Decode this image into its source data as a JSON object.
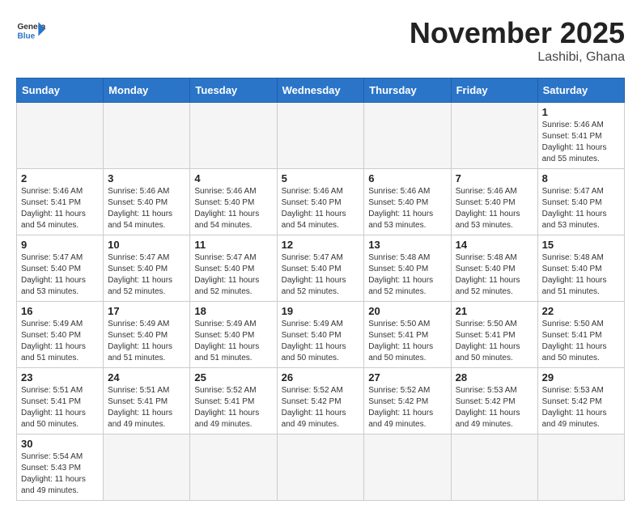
{
  "header": {
    "logo_general": "General",
    "logo_blue": "Blue",
    "month_title": "November 2025",
    "location": "Lashibi, Ghana"
  },
  "weekdays": [
    "Sunday",
    "Monday",
    "Tuesday",
    "Wednesday",
    "Thursday",
    "Friday",
    "Saturday"
  ],
  "days": {
    "1": {
      "sunrise": "5:46 AM",
      "sunset": "5:41 PM",
      "daylight": "11 hours and 55 minutes."
    },
    "2": {
      "sunrise": "5:46 AM",
      "sunset": "5:41 PM",
      "daylight": "11 hours and 54 minutes."
    },
    "3": {
      "sunrise": "5:46 AM",
      "sunset": "5:40 PM",
      "daylight": "11 hours and 54 minutes."
    },
    "4": {
      "sunrise": "5:46 AM",
      "sunset": "5:40 PM",
      "daylight": "11 hours and 54 minutes."
    },
    "5": {
      "sunrise": "5:46 AM",
      "sunset": "5:40 PM",
      "daylight": "11 hours and 54 minutes."
    },
    "6": {
      "sunrise": "5:46 AM",
      "sunset": "5:40 PM",
      "daylight": "11 hours and 53 minutes."
    },
    "7": {
      "sunrise": "5:46 AM",
      "sunset": "5:40 PM",
      "daylight": "11 hours and 53 minutes."
    },
    "8": {
      "sunrise": "5:47 AM",
      "sunset": "5:40 PM",
      "daylight": "11 hours and 53 minutes."
    },
    "9": {
      "sunrise": "5:47 AM",
      "sunset": "5:40 PM",
      "daylight": "11 hours and 53 minutes."
    },
    "10": {
      "sunrise": "5:47 AM",
      "sunset": "5:40 PM",
      "daylight": "11 hours and 52 minutes."
    },
    "11": {
      "sunrise": "5:47 AM",
      "sunset": "5:40 PM",
      "daylight": "11 hours and 52 minutes."
    },
    "12": {
      "sunrise": "5:47 AM",
      "sunset": "5:40 PM",
      "daylight": "11 hours and 52 minutes."
    },
    "13": {
      "sunrise": "5:48 AM",
      "sunset": "5:40 PM",
      "daylight": "11 hours and 52 minutes."
    },
    "14": {
      "sunrise": "5:48 AM",
      "sunset": "5:40 PM",
      "daylight": "11 hours and 52 minutes."
    },
    "15": {
      "sunrise": "5:48 AM",
      "sunset": "5:40 PM",
      "daylight": "11 hours and 51 minutes."
    },
    "16": {
      "sunrise": "5:49 AM",
      "sunset": "5:40 PM",
      "daylight": "11 hours and 51 minutes."
    },
    "17": {
      "sunrise": "5:49 AM",
      "sunset": "5:40 PM",
      "daylight": "11 hours and 51 minutes."
    },
    "18": {
      "sunrise": "5:49 AM",
      "sunset": "5:40 PM",
      "daylight": "11 hours and 51 minutes."
    },
    "19": {
      "sunrise": "5:49 AM",
      "sunset": "5:40 PM",
      "daylight": "11 hours and 50 minutes."
    },
    "20": {
      "sunrise": "5:50 AM",
      "sunset": "5:41 PM",
      "daylight": "11 hours and 50 minutes."
    },
    "21": {
      "sunrise": "5:50 AM",
      "sunset": "5:41 PM",
      "daylight": "11 hours and 50 minutes."
    },
    "22": {
      "sunrise": "5:50 AM",
      "sunset": "5:41 PM",
      "daylight": "11 hours and 50 minutes."
    },
    "23": {
      "sunrise": "5:51 AM",
      "sunset": "5:41 PM",
      "daylight": "11 hours and 50 minutes."
    },
    "24": {
      "sunrise": "5:51 AM",
      "sunset": "5:41 PM",
      "daylight": "11 hours and 49 minutes."
    },
    "25": {
      "sunrise": "5:52 AM",
      "sunset": "5:41 PM",
      "daylight": "11 hours and 49 minutes."
    },
    "26": {
      "sunrise": "5:52 AM",
      "sunset": "5:42 PM",
      "daylight": "11 hours and 49 minutes."
    },
    "27": {
      "sunrise": "5:52 AM",
      "sunset": "5:42 PM",
      "daylight": "11 hours and 49 minutes."
    },
    "28": {
      "sunrise": "5:53 AM",
      "sunset": "5:42 PM",
      "daylight": "11 hours and 49 minutes."
    },
    "29": {
      "sunrise": "5:53 AM",
      "sunset": "5:42 PM",
      "daylight": "11 hours and 49 minutes."
    },
    "30": {
      "sunrise": "5:54 AM",
      "sunset": "5:43 PM",
      "daylight": "11 hours and 49 minutes."
    }
  },
  "labels": {
    "sunrise": "Sunrise:",
    "sunset": "Sunset:",
    "daylight": "Daylight:"
  }
}
